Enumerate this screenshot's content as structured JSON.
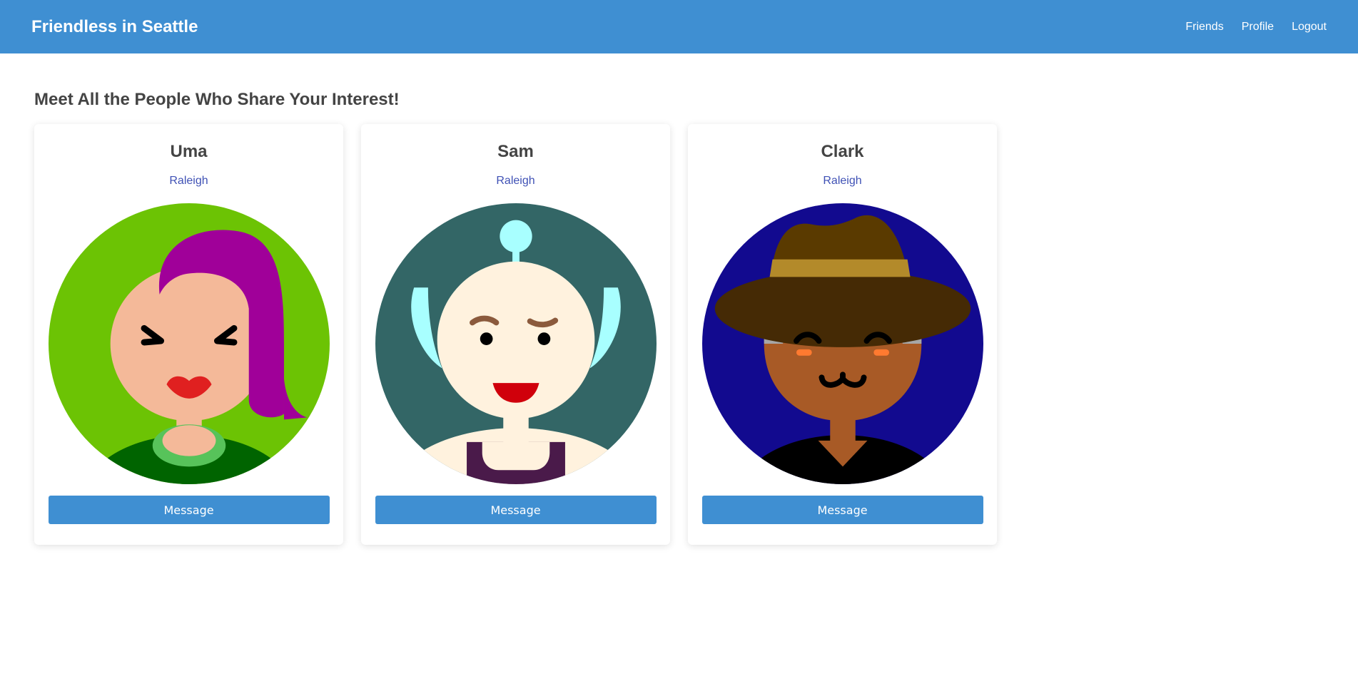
{
  "navbar": {
    "brand": "Friendless in Seattle",
    "links": [
      "Friends",
      "Profile",
      "Logout"
    ]
  },
  "main": {
    "title": "Meet All the People Who Share Your Interest!"
  },
  "people": [
    {
      "name": "Uma",
      "city": "Raleigh",
      "button": "Message",
      "avatar": "avatar-woman-purple-hair"
    },
    {
      "name": "Sam",
      "city": "Raleigh",
      "button": "Message",
      "avatar": "avatar-alien-antenna"
    },
    {
      "name": "Clark",
      "city": "Raleigh",
      "button": "Message",
      "avatar": "avatar-man-fedora-hat"
    }
  ],
  "colors": {
    "navbar": "#3f8fd2",
    "link": "#3f51b5",
    "button": "#3f8fd2"
  }
}
